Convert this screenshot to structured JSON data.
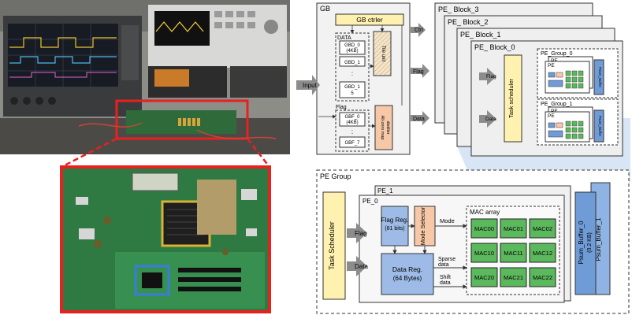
{
  "gb": {
    "title": "GB",
    "ctrler": "GB ctrler",
    "data_label": "DATA",
    "flag_label": "Flag",
    "gbd0": "GBD_0",
    "gbd0_size": "(4KB)",
    "gbd1": "GBD_1",
    "gbd_dots": ":",
    "gbd15": "GBD_1",
    "gbd15_b": "5",
    "gbf0": "GBF_0",
    "gbf0_size": "(4KB)",
    "gbf_dots": ":",
    "gbf7": "GBF_7",
    "tile_unit": "Tile unit",
    "non_zero_map": "All-zero map",
    "non_zero_map_b": "distiller"
  },
  "io": {
    "input": "Input",
    "ctrl": "Ctrl",
    "flag": "Flag",
    "data": "Data"
  },
  "pe_blocks": {
    "b3": "PE_ Block_3",
    "b2": "PE_ Block_2",
    "b1": "PE_ Block_1",
    "b0": "PE_ Block_0",
    "task_scheduler": "Task scheduler",
    "flag": "Flag",
    "data": "Data",
    "group0": "PE_Group_0",
    "group1": "PE_Group_1",
    "pe": "PE",
    "psum_buffer": "Psum_Buffer"
  },
  "pe_group": {
    "title": "PE Group",
    "pe1": "PE_1",
    "pe0": "PE_0",
    "task_scheduler": "Task Scheduler",
    "flag": "Flag",
    "data": "Data",
    "flag_reg": "Flag Reg.",
    "flag_reg_size": "(81 bits)",
    "mode_selector": "Mode Selector",
    "mode": "Mode",
    "data_reg": "Data Reg.",
    "data_reg_size": "(64 Bytes)",
    "sparse_data": "Sparse",
    "sparse_data_b": "data",
    "shift_data": "Shift",
    "shift_data_b": "data",
    "mac_array": "MAC array",
    "macs": [
      [
        "MAC00",
        "MAC01",
        "MAC02"
      ],
      [
        "MAC10",
        "MAC11",
        "MAC12"
      ],
      [
        "MAC20",
        "MAC21",
        "MAC22"
      ]
    ],
    "psum0": "Psum_Buffer_0",
    "psum0_size": "(0.2 KB)",
    "psum1": "Psum_Buffer_1"
  },
  "colors": {
    "red": "#e8201e",
    "peach": "#f7c8a8",
    "yellow": "#fff2b0",
    "blue": "#6f9bd6",
    "green": "#5cb85c",
    "grey": "#bdbdbd"
  }
}
